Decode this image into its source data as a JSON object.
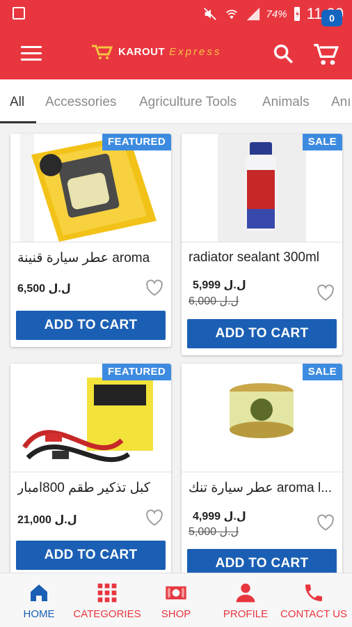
{
  "status_bar": {
    "battery": "74%",
    "time": "11:00"
  },
  "app_bar": {
    "logo_main": "KAROUT",
    "logo_sub": "Express",
    "cart_count": "0"
  },
  "tabs": [
    {
      "label": "All"
    },
    {
      "label": "Accessories"
    },
    {
      "label": "Agriculture Tools"
    },
    {
      "label": "Animals"
    },
    {
      "label": "Anı"
    }
  ],
  "products": [
    {
      "badge": "FEATURED",
      "title": "عطر سيارة قنينة aroma",
      "price": "6,500 ل.ل",
      "old_price": "",
      "button": "ADD TO CART"
    },
    {
      "badge": "SALE",
      "title": "radiator sealant 300ml",
      "price": "5,999 ل.ل",
      "old_price": "6,000 ل.ل",
      "button": "ADD TO CART"
    },
    {
      "badge": "FEATURED",
      "title": "كبل تذكير طقم 800امبار",
      "price": "21,000 ل.ل",
      "old_price": "",
      "button": "ADD TO CART"
    },
    {
      "badge": "SALE",
      "title": "عطر سيارة تنك aroma l...",
      "price": "4,999 ل.ل",
      "old_price": "5,000 ل.ل",
      "button": "ADD TO CART"
    }
  ],
  "bottom_nav": [
    {
      "label": "HOME",
      "icon": "home-icon"
    },
    {
      "label": "CATEGORIES",
      "icon": "grid-icon"
    },
    {
      "label": "SHOP",
      "icon": "money-icon"
    },
    {
      "label": "PROFILE",
      "icon": "person-icon"
    },
    {
      "label": "CONTACT US",
      "icon": "phone-icon"
    }
  ],
  "colors": {
    "primary": "#e8363f",
    "accent": "#1a5fb4",
    "badge": "#3d8be0"
  }
}
